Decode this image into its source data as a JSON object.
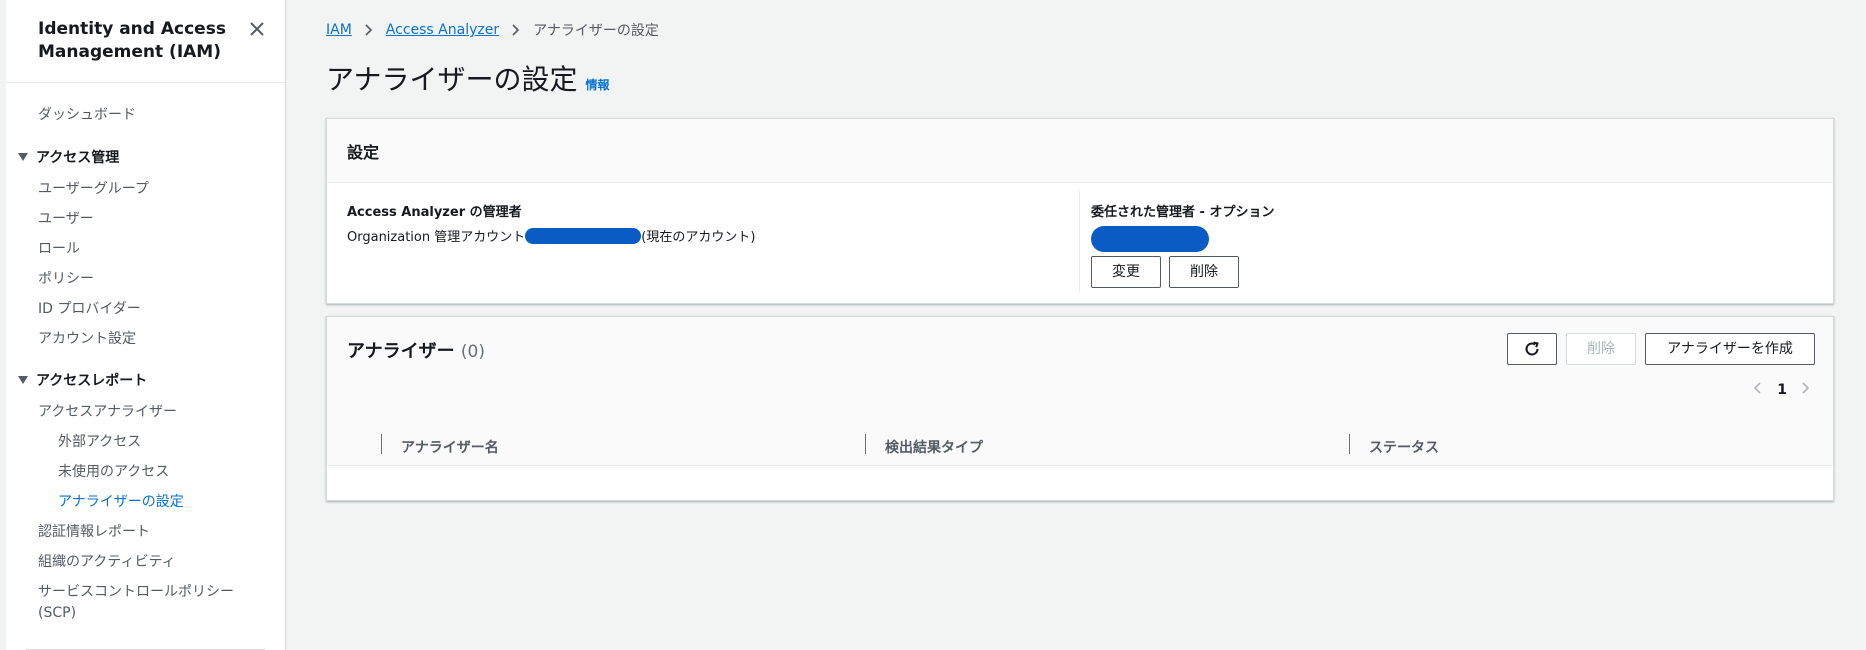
{
  "sidebar": {
    "title": "Identity and Access Management (IAM)",
    "close_icon": "close-icon",
    "items": {
      "dashboard": "ダッシュボード",
      "access_management": "アクセス管理",
      "user_groups": "ユーザーグループ",
      "users": "ユーザー",
      "roles": "ロール",
      "policies": "ポリシー",
      "id_providers": "ID プロバイダー",
      "account_settings": "アカウント設定",
      "access_reports": "アクセスレポート",
      "access_analyzer": "アクセスアナライザー",
      "external_access": "外部アクセス",
      "unused_access": "未使用のアクセス",
      "analyzer_settings": "アナライザーの設定",
      "credential_report": "認証情報レポート",
      "org_activity": "組織のアクティビティ",
      "scp_line1": "サービスコントロールポリシー",
      "scp_line2": "(SCP)"
    }
  },
  "breadcrumb": {
    "iam": "IAM",
    "access_analyzer": "Access Analyzer",
    "current": "アナライザーの設定"
  },
  "page": {
    "title": "アナライザーの設定",
    "info": "情報"
  },
  "settings": {
    "title": "設定",
    "admin_label": "Access Analyzer の管理者",
    "admin_value_prefix": "Organization 管理アカウント",
    "admin_value_suffix": "(現在のアカウント)",
    "delegated_label": "委任された管理者 - オプション",
    "change_button": "変更",
    "delete_button": "削除"
  },
  "analyzers": {
    "title": "アナライザー",
    "count": "(0)",
    "refresh_icon": "refresh-icon",
    "delete_button": "削除",
    "create_button": "アナライザーを作成",
    "page_number": "1",
    "columns": [
      "アナライザー名",
      "検出結果タイプ",
      "ステータス"
    ]
  },
  "colors": {
    "link": "#0972d3",
    "redaction": "#0a5bc4",
    "background": "#f2f3f3"
  }
}
